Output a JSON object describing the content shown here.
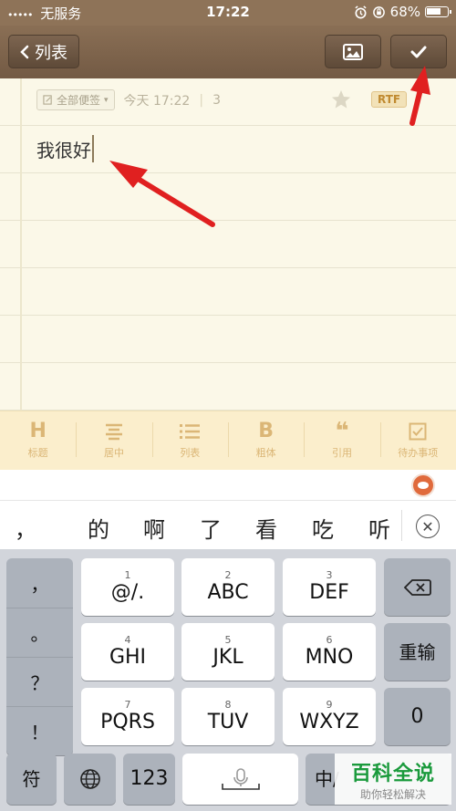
{
  "status_bar": {
    "carrier": "无服务",
    "time": "17:22",
    "battery": "68%"
  },
  "nav": {
    "back_label": "列表"
  },
  "note": {
    "tag_select": "全部便签",
    "date": "今天 17:22",
    "char_count": "3",
    "rtf_badge": "RTF",
    "content": "我很好"
  },
  "toolbar": [
    {
      "label": "标题",
      "glyph": "H"
    },
    {
      "label": "居中",
      "glyph": ""
    },
    {
      "label": "列表",
      "glyph": ""
    },
    {
      "label": "粗体",
      "glyph": "B"
    },
    {
      "label": "引用",
      "glyph": "❝"
    },
    {
      "label": "待办事项",
      "glyph": ""
    }
  ],
  "candidates": [
    "，",
    "的",
    "啊",
    "了",
    "看",
    "吃",
    "听"
  ],
  "keyboard": {
    "punct": [
      "，",
      "。",
      "？",
      "！"
    ],
    "keys": [
      {
        "num": "1",
        "label": "@/."
      },
      {
        "num": "2",
        "label": "ABC"
      },
      {
        "num": "3",
        "label": "DEF"
      },
      {
        "num": "4",
        "label": "GHI"
      },
      {
        "num": "5",
        "label": "JKL"
      },
      {
        "num": "6",
        "label": "MNO"
      },
      {
        "num": "7",
        "label": "PQRS"
      },
      {
        "num": "8",
        "label": "TUV"
      },
      {
        "num": "9",
        "label": "WXYZ"
      }
    ],
    "retype": "重输",
    "zero": "0",
    "symbol": "符",
    "numeric": "123",
    "chinese": "中/"
  },
  "watermark": {
    "title": "百科全说",
    "subtitle": "助你轻松解决"
  },
  "colors": {
    "nav_brown": "#7d6550",
    "accent_gold": "#dbb676",
    "annotation_red": "#e02020"
  }
}
